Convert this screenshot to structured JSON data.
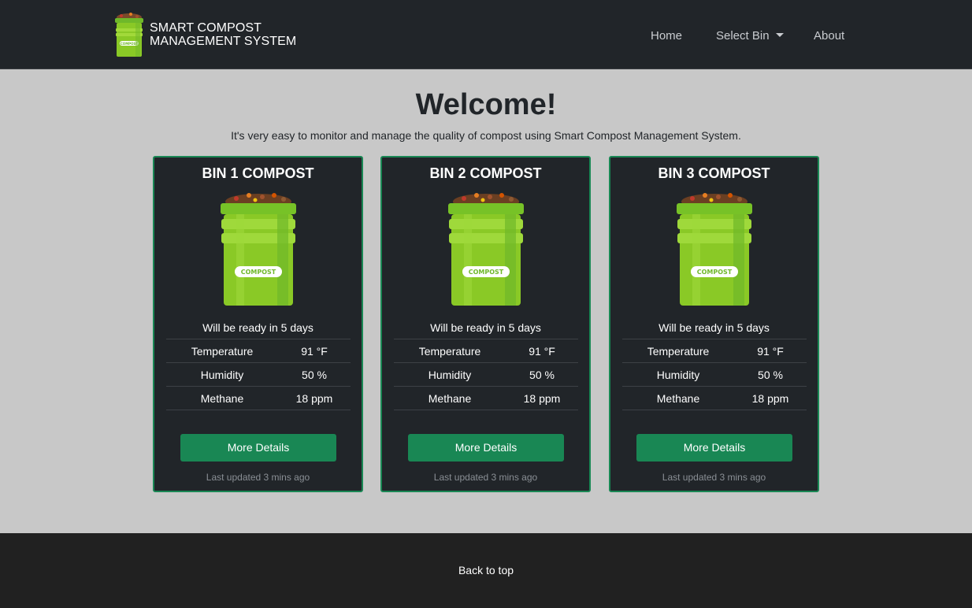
{
  "brand": {
    "line1": "SMART COMPOST",
    "line2": "MANAGEMENT SYSTEM",
    "logo_text": "COMPOST",
    "icon": "compost-bin-icon"
  },
  "nav": {
    "home": "Home",
    "select_bin": "Select Bin",
    "about": "About"
  },
  "hero": {
    "title": "Welcome!",
    "subtitle": "It's very easy to monitor and manage the quality of compost using Smart Compost Management System."
  },
  "bins": [
    {
      "title": "BIN 1 COMPOST",
      "label": "COMPOST",
      "ready": "Will be ready in 5 days",
      "stats": [
        {
          "label": "Temperature",
          "value": "91 °F"
        },
        {
          "label": "Humidity",
          "value": "50 %"
        },
        {
          "label": "Methane",
          "value": "18 ppm"
        }
      ],
      "button": "More Details",
      "updated": "Last updated 3 mins ago"
    },
    {
      "title": "BIN 2 COMPOST",
      "label": "COMPOST",
      "ready": "Will be ready in 5 days",
      "stats": [
        {
          "label": "Temperature",
          "value": "91 °F"
        },
        {
          "label": "Humidity",
          "value": "50 %"
        },
        {
          "label": "Methane",
          "value": "18 ppm"
        }
      ],
      "button": "More Details",
      "updated": "Last updated 3 mins ago"
    },
    {
      "title": "BIN 3 COMPOST",
      "label": "COMPOST",
      "ready": "Will be ready in 5 days",
      "stats": [
        {
          "label": "Temperature",
          "value": "91 °F"
        },
        {
          "label": "Humidity",
          "value": "50 %"
        },
        {
          "label": "Methane",
          "value": "18 ppm"
        }
      ],
      "button": "More Details",
      "updated": "Last updated 3 mins ago"
    }
  ],
  "footer": {
    "back_to_top": "Back to top"
  },
  "colors": {
    "dark": "#212529",
    "accent": "#198754",
    "background": "#c8c8c8",
    "bin_green": "#8ac926"
  }
}
